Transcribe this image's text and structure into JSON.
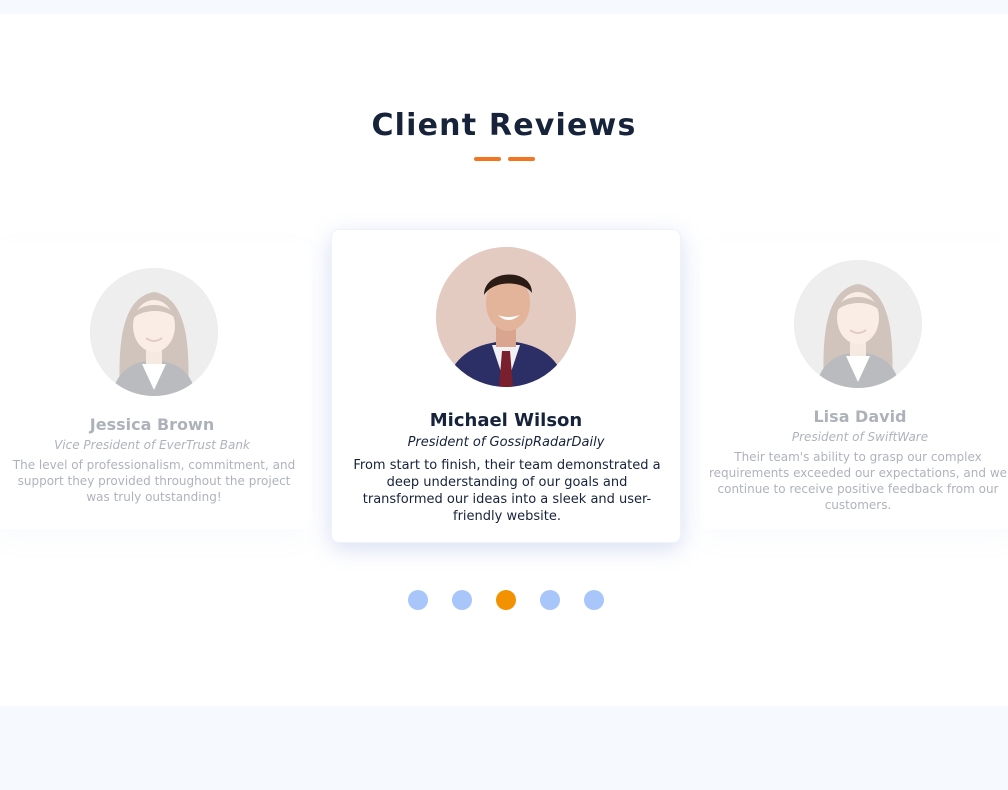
{
  "section": {
    "title": "Client Reviews"
  },
  "reviews": [
    {
      "name": "Jessica Brown",
      "role": "Vice President of EverTrust Bank",
      "quote": "The level of professionalism, commitment, and support they provided throughout the project was truly outstanding!",
      "avatar": "woman-portrait-avatar"
    },
    {
      "name": "Michael Wilson",
      "role": "President of GossipRadarDaily",
      "quote": "From start to finish, their team demonstrated a deep understanding of our goals and transformed our ideas into a sleek and user-friendly website.",
      "avatar": "man-portrait-avatar"
    },
    {
      "name": "Lisa David",
      "role": "President of SwiftWare",
      "quote": "Their team's ability to grasp our complex requirements exceeded our expectations, and we continue to receive positive feedback from our customers.",
      "avatar": "woman-portrait-avatar"
    }
  ],
  "pagination": {
    "count": 5,
    "active_index": 2
  },
  "colors": {
    "title": "#17233b",
    "accent": "#f47521",
    "dot_inactive": "#a9c6fb",
    "dot_active": "#f39200",
    "page_band": "#f6f9fe"
  }
}
